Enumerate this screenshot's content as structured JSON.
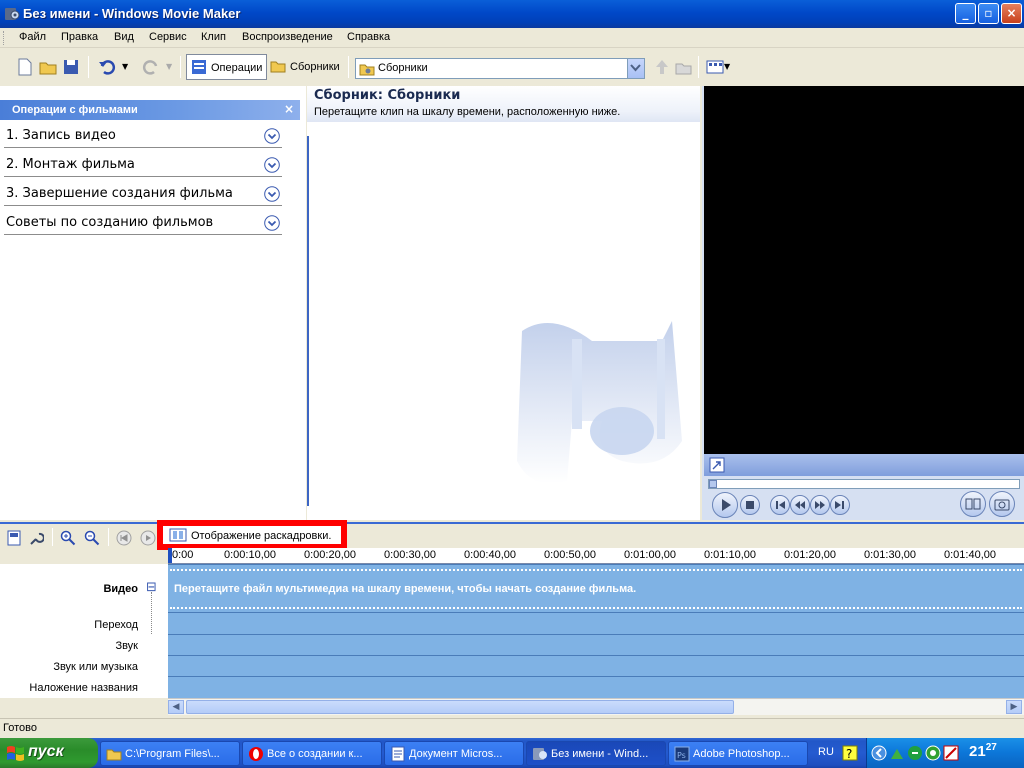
{
  "window": {
    "title": "Без имени - Windows Movie Maker",
    "minimize": "_",
    "maximize": "▫",
    "close": "×"
  },
  "menu": [
    "Файл",
    "Правка",
    "Вид",
    "Сервис",
    "Клип",
    "Воспроизведение",
    "Справка"
  ],
  "toolbar": {
    "operations_label": "Операции",
    "collections_label": "Сборники",
    "collection_combo_value": "Сборники"
  },
  "tasks_pane": {
    "header": "Операции с фильмами",
    "close": "×",
    "items": [
      {
        "label": "1. Запись видео"
      },
      {
        "label": "2. Монтаж фильма"
      },
      {
        "label": "3. Завершение создания фильма"
      },
      {
        "label": "Советы по созданию фильмов"
      }
    ]
  },
  "collections_pane": {
    "title": "Сборник: Сборники",
    "hint": "Перетащите клип на шкалу времени, расположенную ниже."
  },
  "timeline": {
    "storyboard_label": "Отображение раскадровки.",
    "ruler_ticks": [
      "0:00",
      "0:00:10,00",
      "0:00:20,00",
      "0:00:30,00",
      "0:00:40,00",
      "0:00:50,00",
      "0:01:00,00",
      "0:01:10,00",
      "0:01:20,00",
      "0:01:30,00",
      "0:01:40,00"
    ],
    "tracks": {
      "video": "Видео",
      "video_expand": "⊟",
      "transition": "Переход",
      "audio": "Звук",
      "audio_music": "Звук или музыка",
      "title_overlay": "Наложение названия"
    },
    "video_hint": "Перетащите файл мультимедиа на шкалу времени, чтобы начать создание фильма."
  },
  "status_bar": {
    "text": "Готово"
  },
  "taskbar": {
    "start_label": "пуск",
    "buttons": [
      {
        "label": "C:\\Program Files\\..."
      },
      {
        "label": "Все о создании к..."
      },
      {
        "label": "Документ Micros..."
      },
      {
        "label": "Без имени - Wind..."
      },
      {
        "label": "Adobe Photoshop..."
      }
    ],
    "language": "RU",
    "clock_hour": "21",
    "clock_minute": "27"
  },
  "colors": {
    "title_bar": "#0048c8",
    "tasks_header": "#4a7ed8",
    "timeline_track": "#7fb2e4",
    "highlight_box": "#ff0000",
    "start_button": "#2a8c2a"
  }
}
